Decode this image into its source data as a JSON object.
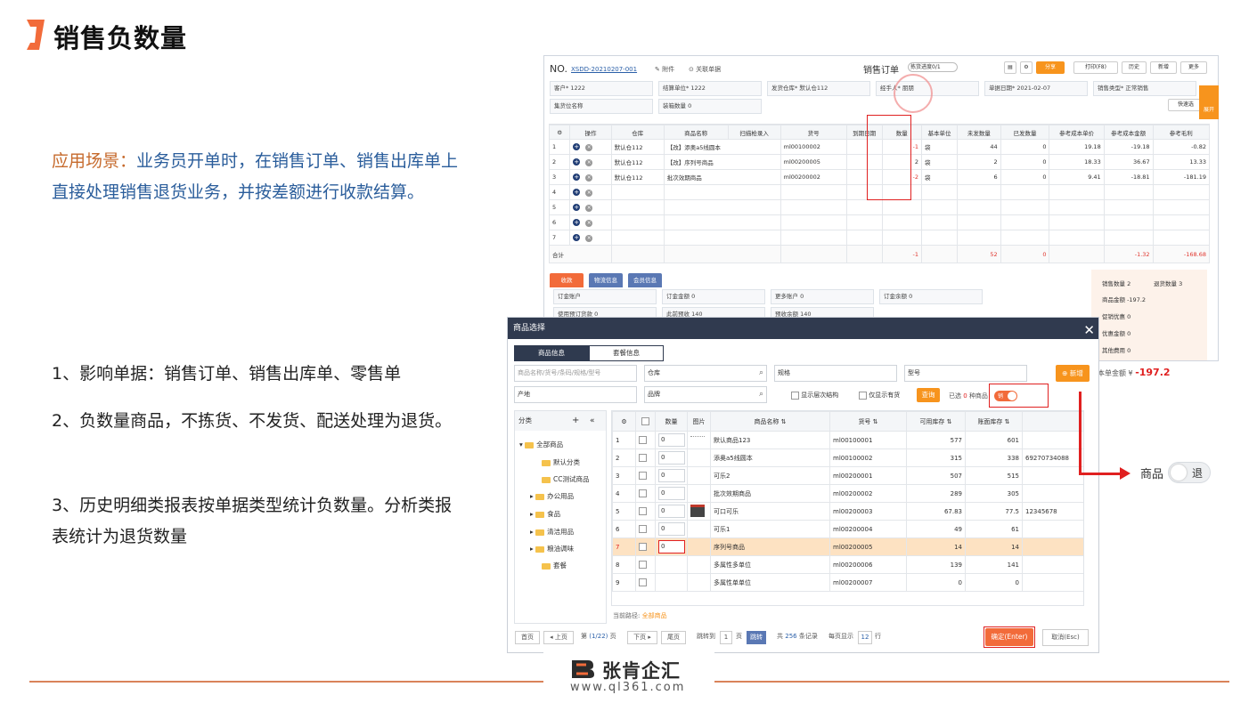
{
  "slide": {
    "title": "销售负数量",
    "scene_label": "应用场景：",
    "scene_text": "业务员开单时，在销售订单、销售出库单上直接处理销售退货业务，并按差额进行收款结算。",
    "points": [
      "1、影响单据：销售订单、销售出库单、零售单",
      "2、负数量商品，不拣货、不发货、配送处理为退货。",
      "3、历史明细类报表按单据类型统计负数量。分析类报表统计为退货数量"
    ],
    "brand_name": "张肯企汇",
    "brand_url": "www.ql361.com"
  },
  "sales_order": {
    "no_label": "NO.",
    "no_value": "XSDD-20210207-001",
    "attach": "附件",
    "related": "关联单据",
    "doc_title": "销售订单",
    "progress": "拣货进度0/1",
    "share": "分享",
    "print": "打印(F8)",
    "history": "历史",
    "new": "新增",
    "more": "更多",
    "customer_label": "客户*",
    "customer": "1222",
    "settle_label": "结算单位*",
    "settle": "1222",
    "warehouse_label": "发货仓库*",
    "warehouse": "默认仓112",
    "handler_label": "经手人*",
    "handler": "朋朋",
    "date_label": "单据日期*",
    "date": "2021-02-07",
    "type_label": "销售类型*",
    "type": "正常销售",
    "cargo_label": "集货位名称",
    "box_label": "装箱数量",
    "box": "0",
    "quick_select": "快速选",
    "columns": [
      "",
      "操作",
      "仓库",
      "商品名称",
      "扫描枪录入",
      "货号",
      "到期日期",
      "数量",
      "基本单位",
      "未发数量",
      "已发数量",
      "参考成本单价",
      "参考成本金额",
      "参考毛利"
    ],
    "rows": [
      {
        "idx": "1",
        "wh": "默认仓112",
        "name": "【改】添奥a5线圆本",
        "sku": "ml00100002",
        "qty": "-1",
        "unit": "袋",
        "unsent": "44",
        "sent": "0",
        "cost": "19.18",
        "amount": "-19.18",
        "profit": "-0.82"
      },
      {
        "idx": "2",
        "wh": "默认仓112",
        "name": "【改】序列号商品",
        "sku": "ml00200005",
        "qty": "2",
        "unit": "袋",
        "unsent": "2",
        "sent": "0",
        "cost": "18.33",
        "amount": "36.67",
        "profit": "13.33"
      },
      {
        "idx": "3",
        "wh": "默认仓112",
        "name": "批次效期商品",
        "sku": "ml00200002",
        "qty": "-2",
        "unit": "袋",
        "unsent": "6",
        "sent": "0",
        "cost": "9.41",
        "amount": "-18.81",
        "profit": "-181.19"
      }
    ],
    "empty_rows": [
      "4",
      "5",
      "6",
      "7"
    ],
    "total_label": "合计",
    "total_qty": "-1",
    "total_unsent": "52",
    "total_sent": "0",
    "total_amount": "-1.32",
    "total_profit": "-168.68",
    "tabs": [
      "收款",
      "物流信息",
      "会员信息"
    ],
    "pay": {
      "order_account": "订金账户",
      "order_amount": "订金金额",
      "order_amount_val": "0",
      "more_account": "更多账户",
      "more_account_val": "0",
      "order_balance": "订金余额",
      "order_balance_val": "0",
      "use_prepay": "使用预订货款",
      "use_prepay_val": "0",
      "prepay": "此前预收",
      "prepay_val": "140",
      "prepay_balance": "预收余额",
      "prepay_balance_val": "140"
    },
    "summary": {
      "sales_qty": "销售数量",
      "sales_qty_val": "2",
      "return_qty": "退货数量",
      "return_qty_val": "3",
      "goods_amt": "商品金额",
      "goods_amt_val": "-197.2",
      "promo": "促销优惠",
      "promo_val": "0",
      "discount": "优惠金额",
      "discount_val": "0",
      "other_fee": "其他费用",
      "other_fee_val": "0"
    },
    "side_tab": "展开",
    "order_total_label": "本单金额",
    "order_total_currency": "¥",
    "order_total": "-197.2"
  },
  "dialog": {
    "title": "商品选择",
    "tab_goods": "商品信息",
    "tab_combo": "套餐信息",
    "search_placeholder": "商品名称/货号/条码/规格/型号",
    "warehouse": "仓库",
    "spec": "规格",
    "model": "型号",
    "new": "新增",
    "origin": "产地",
    "brand": "品牌",
    "show_tree": "显示层次结构",
    "only_stock": "仅显示有货",
    "query": "查询",
    "selected_prefix": "已选",
    "selected_count": "0",
    "selected_suffix": "种商品",
    "return_toggle": "销",
    "tree_title": "分类",
    "tree": [
      "全部商品",
      "默认分类",
      "CC测试商品",
      "办公用品",
      "食品",
      "清洁用品",
      "粮油调味",
      "套餐"
    ],
    "columns": [
      "",
      "",
      "数量",
      "图片",
      "商品名称",
      "货号",
      "可用库存",
      "账面库存",
      ""
    ],
    "rows": [
      {
        "idx": "1",
        "qty": "0",
        "name": "默认商品123",
        "sku": "ml00100001",
        "avail": "577",
        "book": "601",
        "extra": ""
      },
      {
        "idx": "2",
        "qty": "0",
        "name": "添奥a5线圆本",
        "sku": "ml00100002",
        "avail": "315",
        "book": "338",
        "extra": "69270734088"
      },
      {
        "idx": "3",
        "qty": "0",
        "name": "可乐2",
        "sku": "ml00200001",
        "avail": "507",
        "book": "515",
        "extra": ""
      },
      {
        "idx": "4",
        "qty": "0",
        "name": "批次效期商品",
        "sku": "ml00200002",
        "avail": "289",
        "book": "305",
        "extra": ""
      },
      {
        "idx": "5",
        "qty": "0",
        "name": "可口可乐",
        "sku": "ml00200003",
        "avail": "67.83",
        "book": "77.5",
        "extra": "12345678"
      },
      {
        "idx": "6",
        "qty": "0",
        "name": "可乐1",
        "sku": "ml00200004",
        "avail": "49",
        "book": "61",
        "extra": ""
      },
      {
        "idx": "7",
        "qty": "0",
        "name": "序列号商品",
        "sku": "ml00200005",
        "avail": "14",
        "book": "14",
        "extra": ""
      },
      {
        "idx": "8",
        "qty": "",
        "name": "多属性多单位",
        "sku": "ml00200006",
        "avail": "139",
        "book": "141",
        "extra": ""
      },
      {
        "idx": "9",
        "qty": "",
        "name": "多属性单单位",
        "sku": "ml00200007",
        "avail": "0",
        "book": "0",
        "extra": ""
      }
    ],
    "path_label": "当前路径:",
    "path_value": "全部商品",
    "first": "首页",
    "prev": "上页",
    "page_prefix": "第",
    "page_value": "(1/22)",
    "page_suffix": "页",
    "next": "下页",
    "last": "尾页",
    "jump_to": "跳转到",
    "jump_page": "1",
    "jump_suffix": "页",
    "jump_btn": "跳转",
    "records_prefix": "共",
    "records": "256",
    "records_suffix": "条记录",
    "per_page_prefix": "每页显示",
    "per_page": "12",
    "per_page_suffix": "行",
    "confirm": "确定(Enter)",
    "cancel": "取消(Esc)"
  },
  "callout": {
    "label": "商品",
    "toggle": "退"
  },
  "colors": {
    "accent_orange": "#f7941d",
    "highlight_red": "#e02020",
    "nav_dark": "#303a4f"
  }
}
